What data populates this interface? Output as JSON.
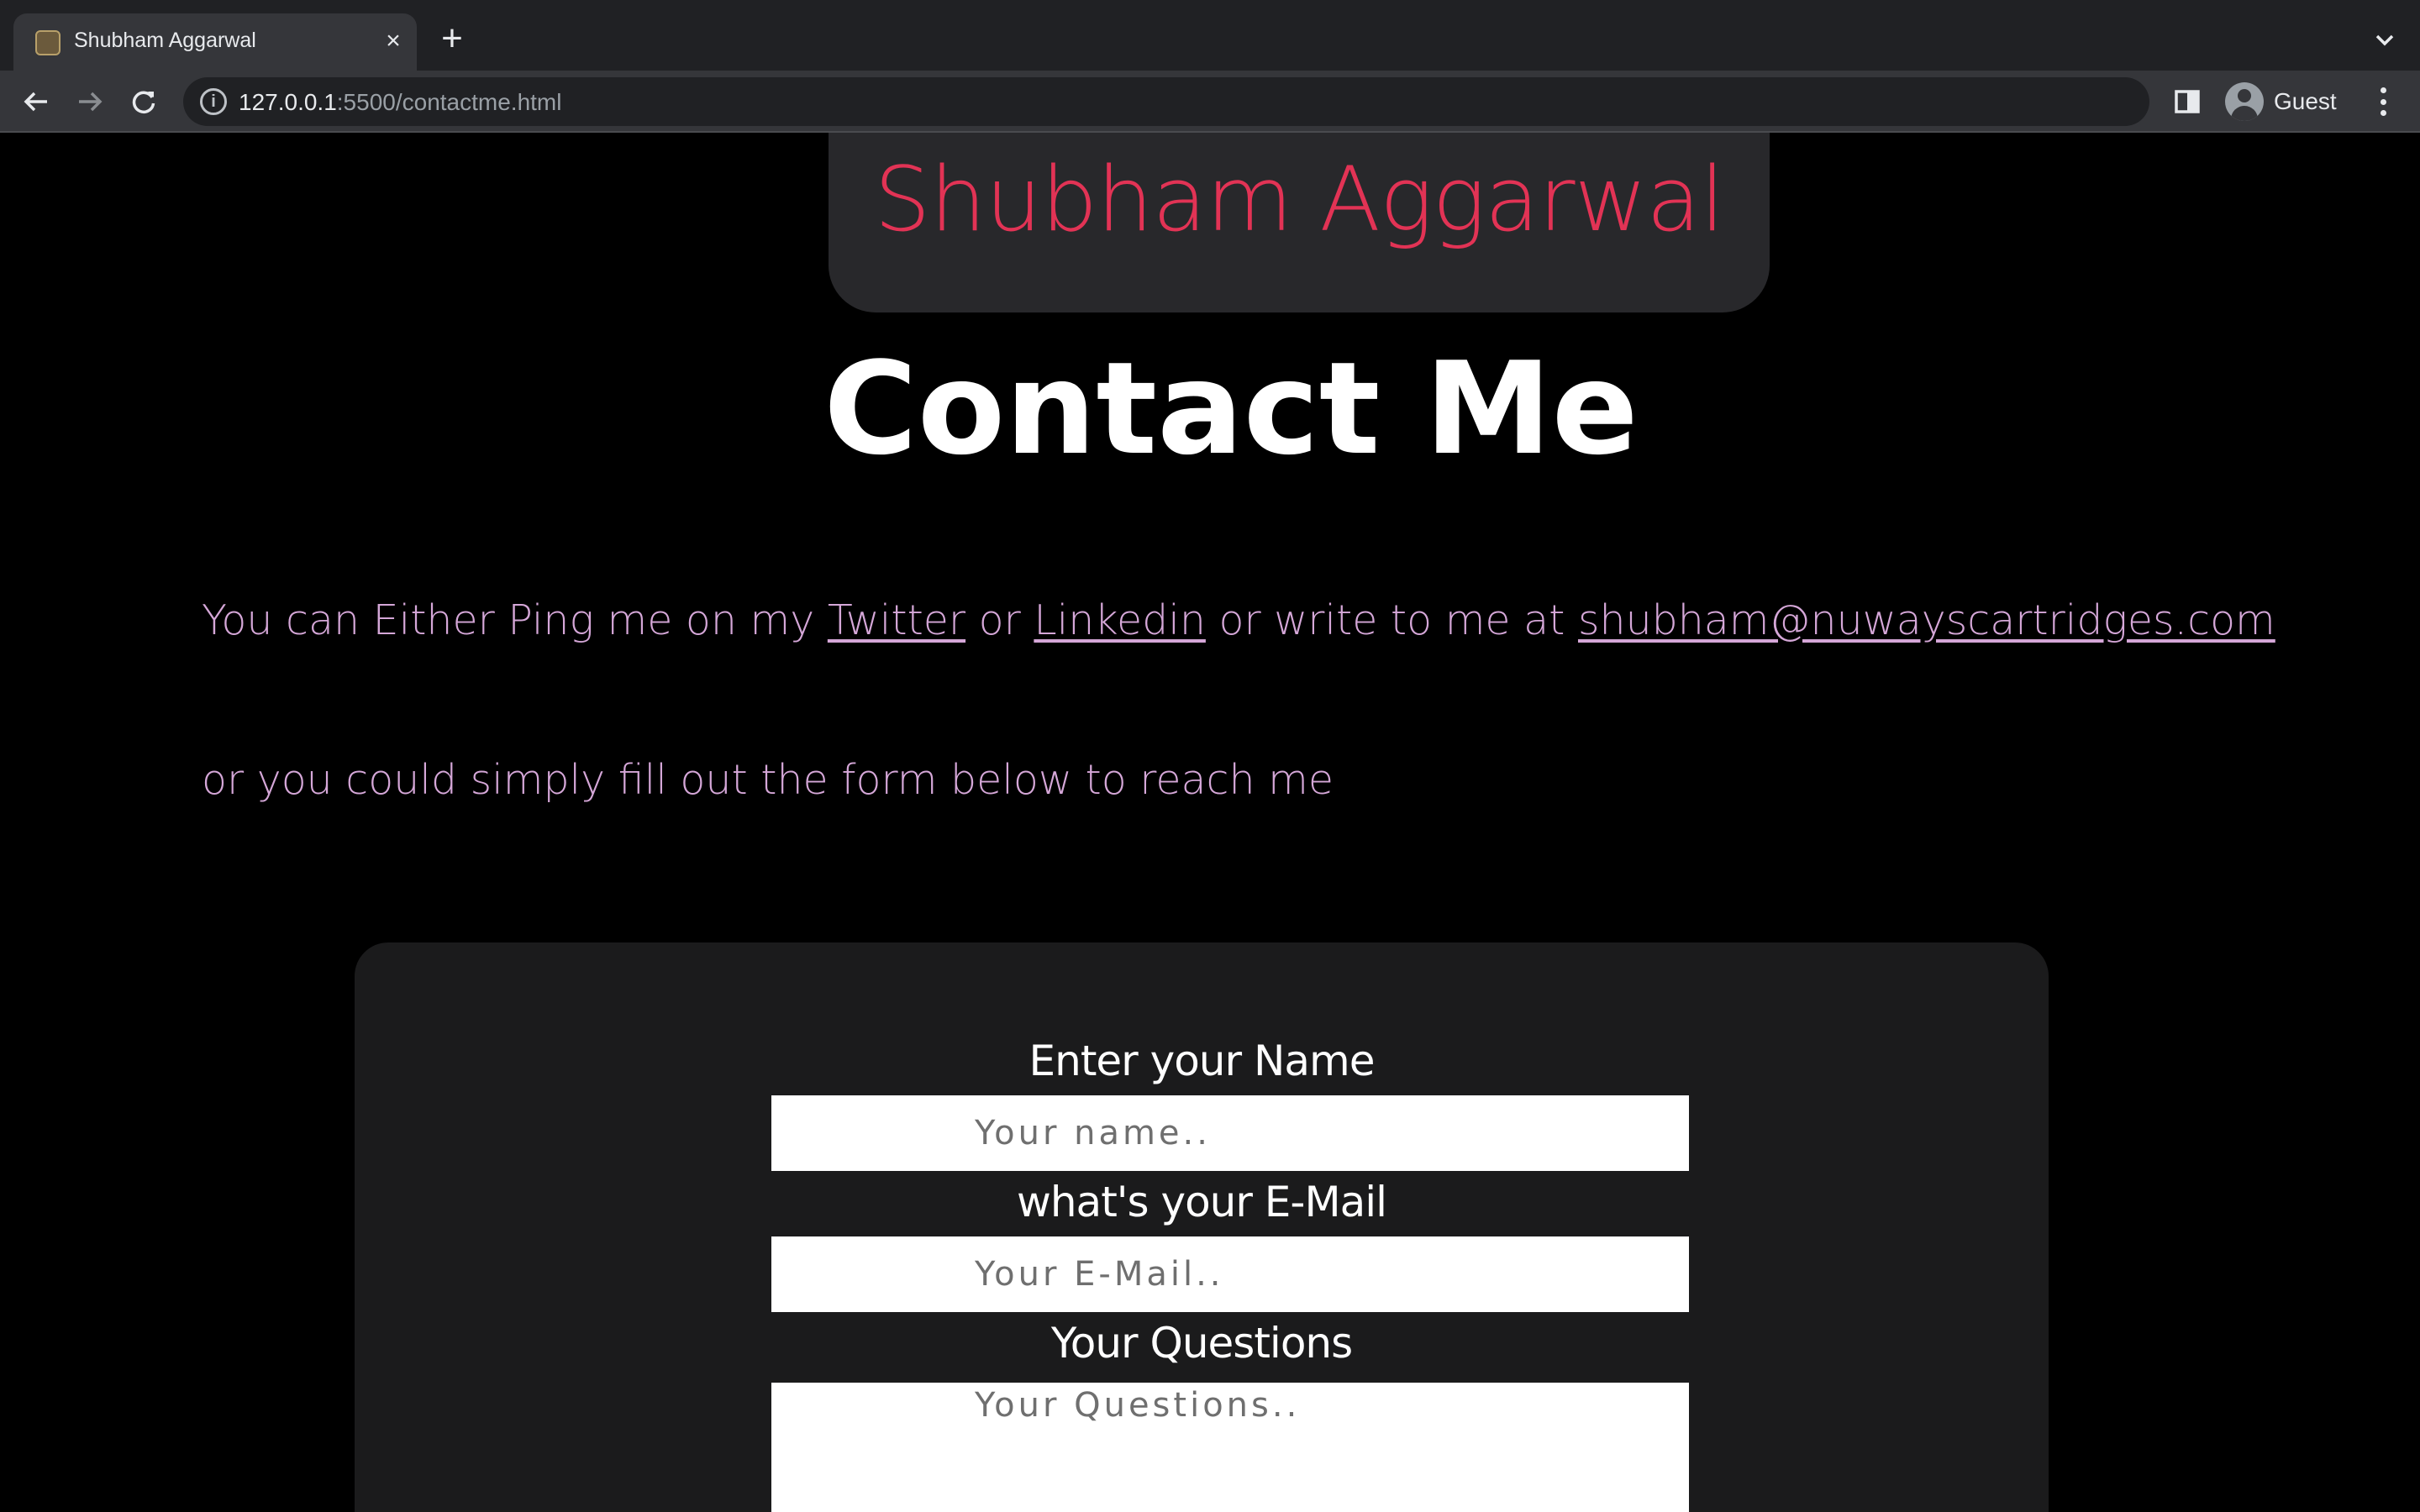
{
  "browser": {
    "tab": {
      "title": "Shubham Aggarwal",
      "close_glyph": "×",
      "favicon": "site-favicon-icon"
    },
    "new_tab_glyph": "+",
    "address": {
      "host": "127.0.0.1",
      "path": ":5500/contactme.html"
    },
    "profile": {
      "label": "Guest"
    }
  },
  "site": {
    "brand": "Shubham Aggarwal",
    "title": "Contact Me",
    "intro": {
      "prefix": "You can Either Ping me on my ",
      "twitter": "Twitter",
      "or1": " or ",
      "linkedin": "Linkedin",
      "or2": " or write to me at ",
      "email": "shubham@nuwayscartridges.com"
    },
    "intro2": "or you could simply fill out the form below to reach me"
  },
  "form": {
    "name_label": "Enter your Name",
    "name_placeholder": "Your name..",
    "email_label": "what's your E-Mail",
    "email_placeholder": "Your E-Mail..",
    "questions_label": "Your Questions",
    "questions_placeholder": "Your Questions.."
  },
  "colors": {
    "brand": "#e23355",
    "intro_text": "#d5a7d8",
    "card_bg": "#1b1b1c",
    "page_bg": "#000000"
  }
}
